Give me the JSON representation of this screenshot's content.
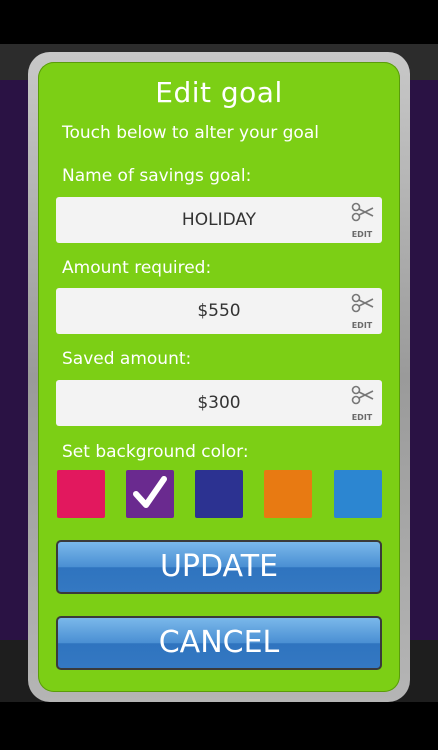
{
  "dialog": {
    "title": "Edit goal",
    "subtitle": "Touch below to alter your goal",
    "fields": [
      {
        "label": "Name of savings goal:",
        "value": "HOLIDAY",
        "edit_label": "EDIT"
      },
      {
        "label": "Amount required:",
        "value": "$550",
        "edit_label": "EDIT"
      },
      {
        "label": "Saved amount:",
        "value": "$300",
        "edit_label": "EDIT"
      }
    ],
    "color_label": "Set background color:",
    "swatches": [
      {
        "color": "#e2185e",
        "selected": false
      },
      {
        "color": "#6a2a8f",
        "selected": true
      },
      {
        "color": "#2c3291",
        "selected": false
      },
      {
        "color": "#e87a12",
        "selected": false
      },
      {
        "color": "#2c86d1",
        "selected": false
      }
    ],
    "update_label": "UPDATE",
    "cancel_label": "CANCEL"
  },
  "colors": {
    "dialog_green": "#7ccf15",
    "button_blue": "#3478c2",
    "app_background": "#2a1244"
  }
}
